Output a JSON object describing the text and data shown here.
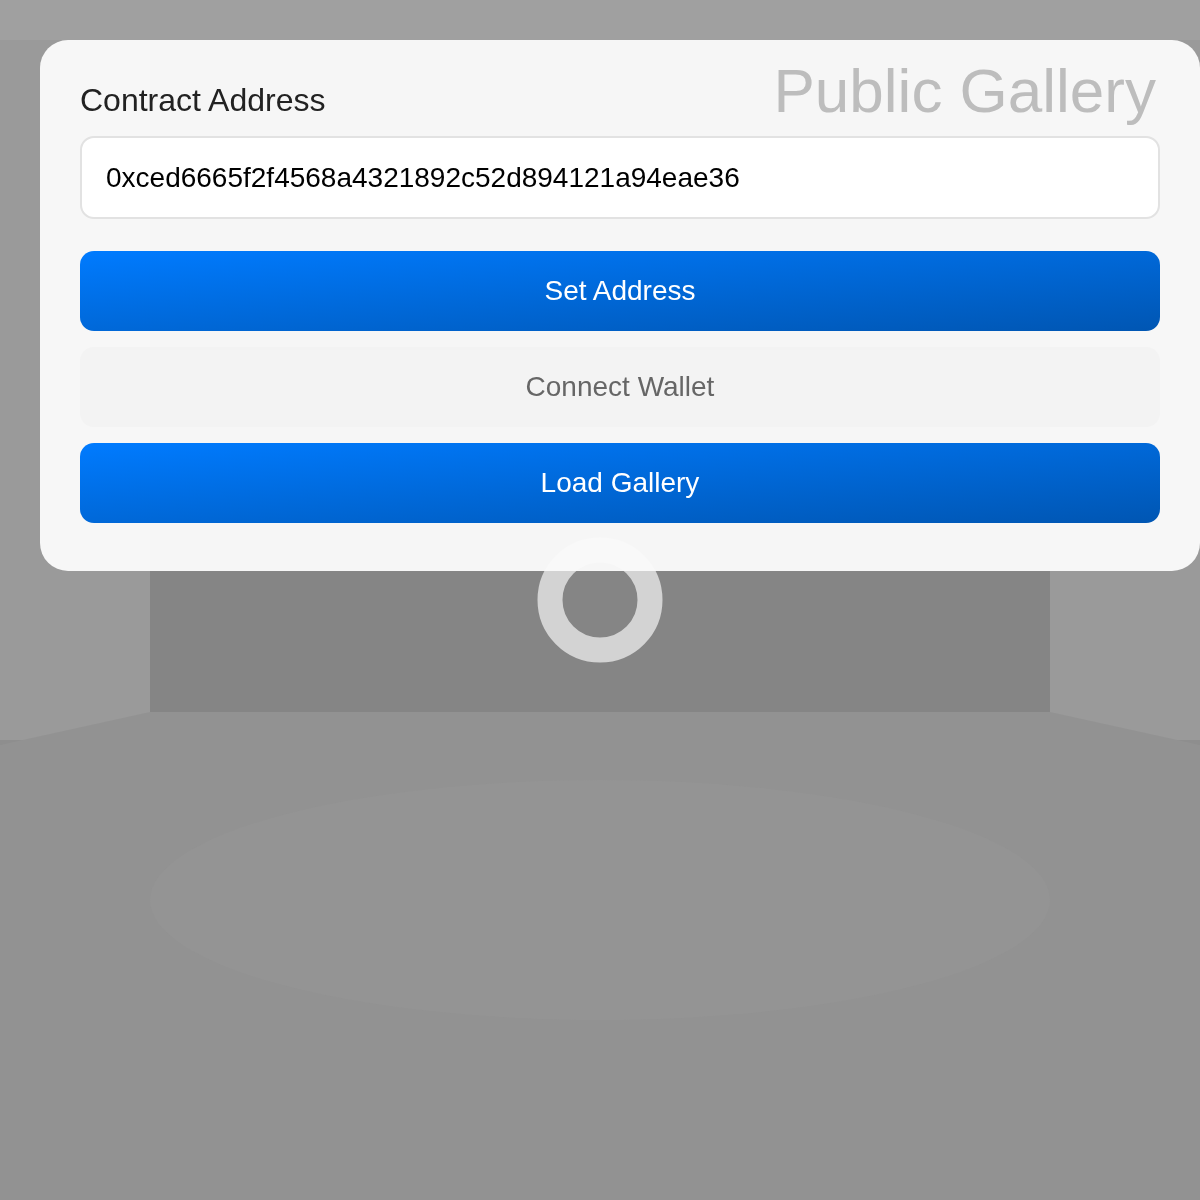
{
  "gallery_title": "Public Gallery",
  "form": {
    "label": "Contract Address",
    "address": {
      "value": "0xced6665f2f4568a4321892c52d894121a94eae36"
    },
    "buttons": [
      {
        "label": "Set Address",
        "kind": "primary"
      },
      {
        "label": "Connect Wallet",
        "kind": "secondary"
      },
      {
        "label": "Load Gallery",
        "kind": "primary"
      }
    ]
  }
}
